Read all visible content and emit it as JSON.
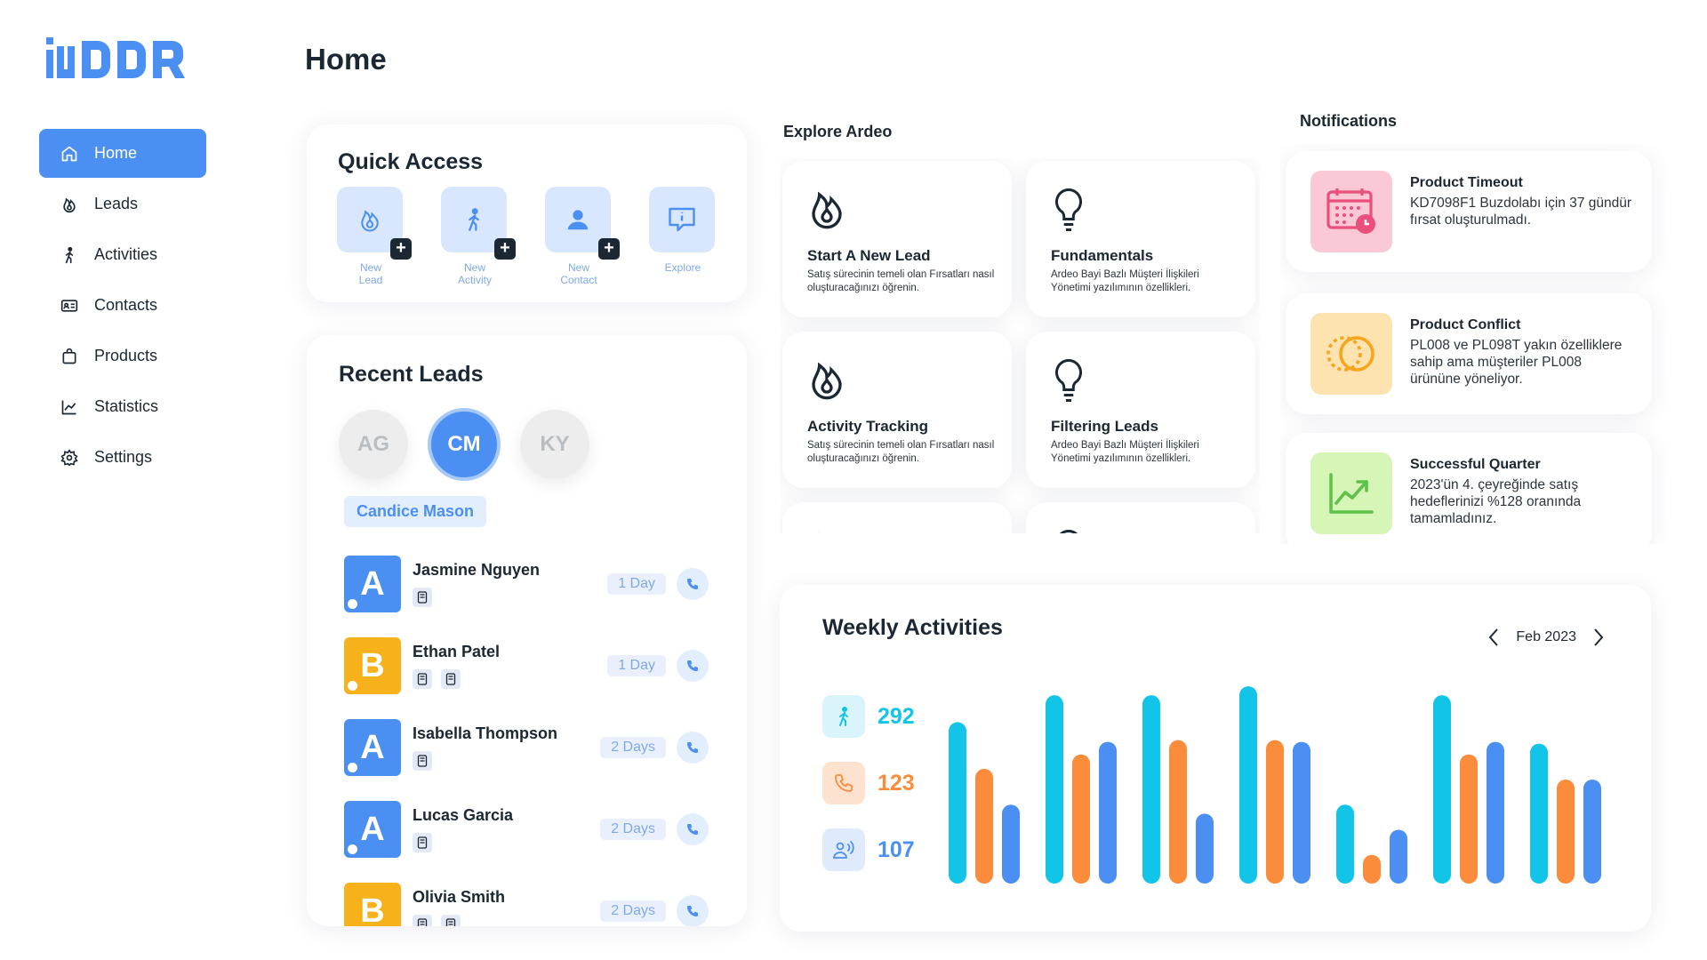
{
  "page": {
    "title": "Home"
  },
  "logo": {
    "text": "iDDR"
  },
  "sidebar": {
    "items": [
      {
        "label": "Home",
        "icon": "home-icon",
        "active": true
      },
      {
        "label": "Leads",
        "icon": "flame-icon"
      },
      {
        "label": "Activities",
        "icon": "walking-person-icon"
      },
      {
        "label": "Contacts",
        "icon": "contact-card-icon"
      },
      {
        "label": "Products",
        "icon": "bag-icon"
      },
      {
        "label": "Statistics",
        "icon": "chart-line-icon"
      },
      {
        "label": "Settings",
        "icon": "gear-icon"
      }
    ]
  },
  "quick_access": {
    "title": "Quick Access",
    "items": [
      {
        "line1": "New",
        "line2": "Lead",
        "icon": "flame-icon"
      },
      {
        "line1": "New",
        "line2": "Activity",
        "icon": "walking-person-icon"
      },
      {
        "line1": "New",
        "line2": "Contact",
        "icon": "person-icon"
      },
      {
        "line1": "Explore",
        "line2": "",
        "icon": "info-bubble-icon"
      }
    ]
  },
  "recent_leads": {
    "title": "Recent Leads",
    "avatars": [
      "AG",
      "CM",
      "KY"
    ],
    "selected_name": "Candice Mason",
    "leads": [
      {
        "initial": "A",
        "name": "Jasmine Nguyen",
        "days": "1 Day",
        "docs": 1,
        "color": "#4c8ff2"
      },
      {
        "initial": "B",
        "name": "Ethan Patel",
        "days": "1 Day",
        "docs": 2,
        "color": "#f7b21b"
      },
      {
        "initial": "A",
        "name": "Isabella Thompson",
        "days": "2 Days",
        "docs": 1,
        "color": "#4c8ff2"
      },
      {
        "initial": "A",
        "name": "Lucas Garcia",
        "days": "2 Days",
        "docs": 1,
        "color": "#4c8ff2"
      },
      {
        "initial": "B",
        "name": "Olivia Smith",
        "days": "2 Days",
        "docs": 2,
        "color": "#f7b21b"
      }
    ]
  },
  "explore": {
    "title": "Explore Ardeo",
    "cards": [
      {
        "title": "Start A New Lead",
        "desc": "Satış sürecinin temeli olan Fırsatları nasıl oluşturacağınızı öğrenin.",
        "icon": "flame-icon"
      },
      {
        "title": "Fundamentals",
        "desc": "Ardeo Bayi Bazlı Müşteri İlişkileri Yönetimi yazılımının özellikleri.",
        "icon": "lightbulb-icon"
      },
      {
        "title": "Activity Tracking",
        "desc": "Satış sürecinin temeli olan Fırsatları nasıl oluşturacağınızı öğrenin.",
        "icon": "flame-icon"
      },
      {
        "title": "Filtering Leads",
        "desc": "Ardeo Bayi Bazlı Müşteri İlişkileri Yönetimi yazılımının özellikleri.",
        "icon": "lightbulb-icon"
      }
    ]
  },
  "notifications": {
    "title": "Notifications",
    "items": [
      {
        "title": "Product Timeout",
        "body": "KD7098F1 Buzdolabı için 37 gündür fırsat oluşturulmadı.",
        "icon": "calendar-clock-icon",
        "tile": "#fbc9d6"
      },
      {
        "title": "Product Conflict",
        "body": "PL008 ve PL098T yakın özelliklere sahip ama müşteriler PL008 ürününe yöneliyor.",
        "icon": "overlap-circles-icon",
        "tile": "#fde3b0"
      },
      {
        "title": "Successful Quarter",
        "body": "2023'ün 4. çeyreğinde satış hedeflerinizi %128 oranında tamamladınız.",
        "icon": "trend-up-icon",
        "tile": "#d8f5b8"
      }
    ]
  },
  "weekly": {
    "title": "Weekly Activities",
    "period": "Feb 2023",
    "stats": [
      {
        "value": "292",
        "icon": "walking-person-icon",
        "color": "#12c4e8"
      },
      {
        "value": "123",
        "icon": "phone-icon",
        "color": "#fb8c3c"
      },
      {
        "value": "107",
        "icon": "meeting-icon",
        "color": "#4c8ff2"
      }
    ]
  },
  "chart_data": {
    "type": "bar",
    "categories": [
      "",
      "",
      "",
      "",
      "",
      "",
      ""
    ],
    "series": [
      {
        "values": [
          90,
          105,
          105,
          110,
          44,
          105,
          78
        ],
        "color": "#12c4e8"
      },
      {
        "values": [
          64,
          72,
          80,
          80,
          16,
          72,
          58
        ],
        "color": "#fb8c3c"
      },
      {
        "values": [
          44,
          79,
          39,
          79,
          30,
          79,
          58
        ],
        "color": "#4c8ff2"
      }
    ],
    "ylim": [
      0,
      115
    ],
    "grid": false,
    "legend": "none"
  }
}
